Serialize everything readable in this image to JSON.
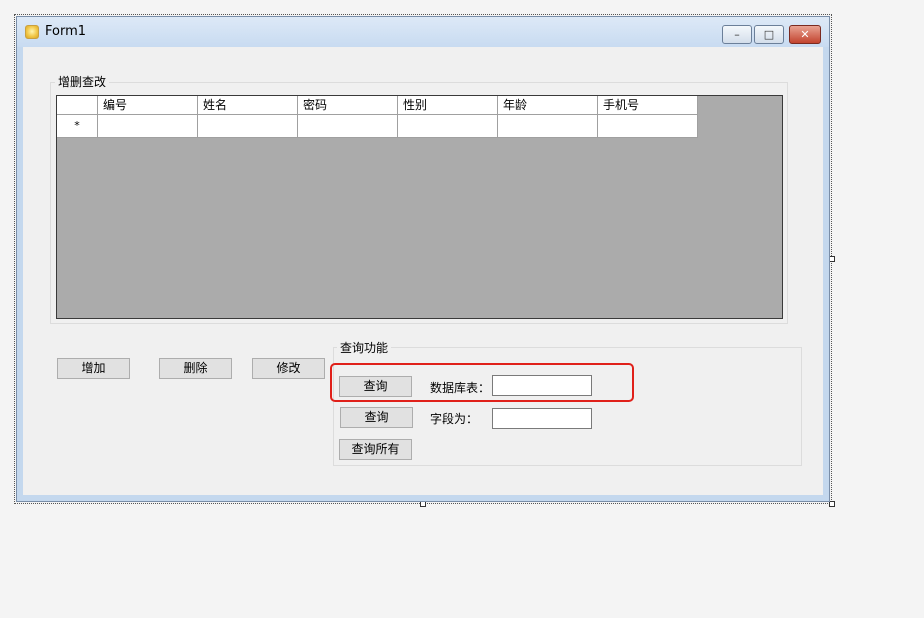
{
  "window": {
    "title": "Form1",
    "minimize": "–",
    "maximize": "□",
    "close": "✕"
  },
  "crud_group": {
    "title": "增删查改",
    "columns": [
      "编号",
      "姓名",
      "密码",
      "性别",
      "年龄",
      "手机号"
    ],
    "new_row_marker": "*"
  },
  "actions": {
    "add": "增加",
    "delete": "删除",
    "modify": "修改"
  },
  "query_group": {
    "title": "查询功能",
    "query_button_1": "查询",
    "table_label": "数据库表：",
    "table_value": "",
    "query_button_2": "查询",
    "field_label": "字段为：",
    "field_value": "",
    "query_all_button": "查询所有"
  },
  "colors": {
    "highlight": "#e0201a",
    "grid_bg": "#ababab",
    "client_bg": "#f0f0f0"
  }
}
